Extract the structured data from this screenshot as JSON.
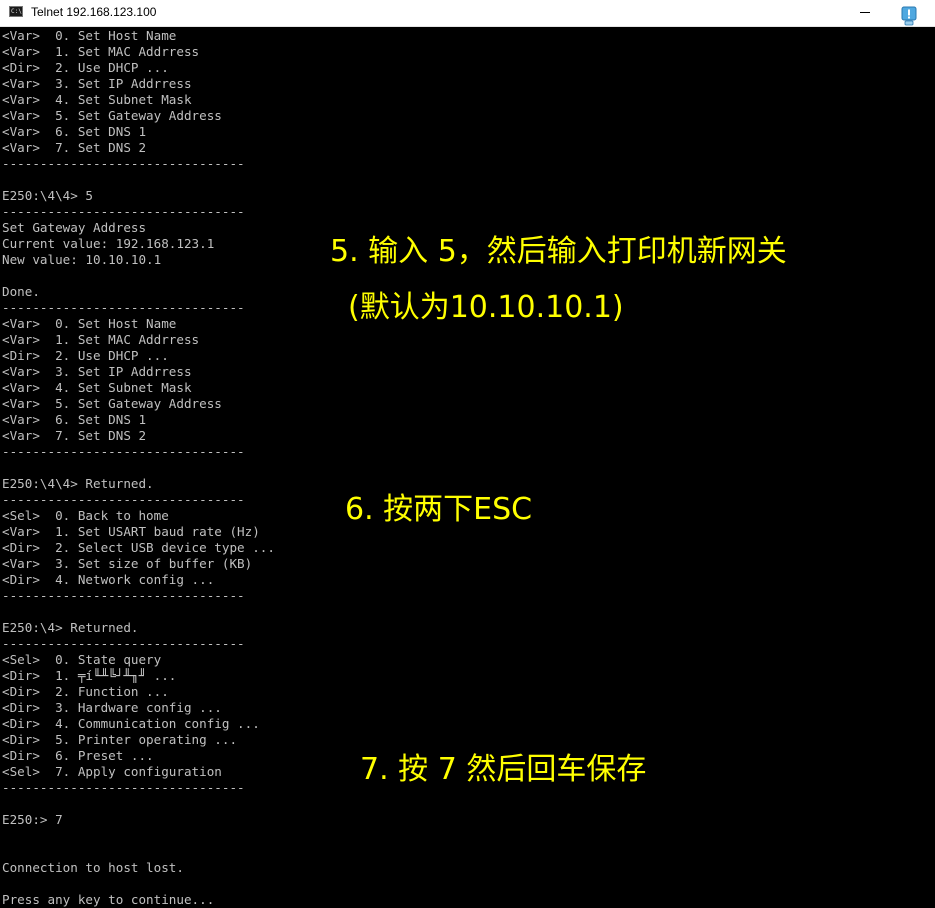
{
  "window": {
    "title": "Telnet 192.168.123.100",
    "app_icon_glyph": "C:\\",
    "minimize_glyph": ""
  },
  "terminal": {
    "lines": [
      "<Var>  0. Set Host Name",
      "<Var>  1. Set MAC Addrress",
      "<Dir>  2. Use DHCP ...",
      "<Var>  3. Set IP Addrress",
      "<Var>  4. Set Subnet Mask",
      "<Var>  5. Set Gateway Address",
      "<Var>  6. Set DNS 1",
      "<Var>  7. Set DNS 2",
      "--------------------------------",
      "",
      "E250:\\4\\4> 5",
      "--------------------------------",
      "Set Gateway Address",
      "Current value: 192.168.123.1",
      "New value: 10.10.10.1",
      "",
      "Done.",
      "--------------------------------",
      "<Var>  0. Set Host Name",
      "<Var>  1. Set MAC Addrress",
      "<Dir>  2. Use DHCP ...",
      "<Var>  3. Set IP Addrress",
      "<Var>  4. Set Subnet Mask",
      "<Var>  5. Set Gateway Address",
      "<Var>  6. Set DNS 1",
      "<Var>  7. Set DNS 2",
      "--------------------------------",
      "",
      "E250:\\4\\4> Returned.",
      "--------------------------------",
      "<Sel>  0. Back to home",
      "<Var>  1. Set USART baud rate (Hz)",
      "<Dir>  2. Select USB device type ...",
      "<Var>  3. Set size of buffer (KB)",
      "<Dir>  4. Network config ...",
      "--------------------------------",
      "",
      "E250:\\4> Returned.",
      "--------------------------------",
      "<Sel>  0. State query",
      "<Dir>  1. ╤í╙╨╚┘╨╖╜ ...",
      "<Dir>  2. Function ...",
      "<Dir>  3. Hardware config ...",
      "<Dir>  4. Communication config ...",
      "<Dir>  5. Printer operating ...",
      "<Dir>  6. Preset ...",
      "<Sel>  7. Apply configuration",
      "--------------------------------",
      "",
      "E250:> 7",
      "",
      "",
      "Connection to host lost.",
      "",
      "Press any key to continue..."
    ]
  },
  "annotations": {
    "step5_line1": "5. 输入 5，然后输入打印机新网关",
    "step5_line2": "(默认为10.10.10.1)",
    "step6": "6. 按两下ESC",
    "step7": "7. 按 7 然后回车保存"
  },
  "colors": {
    "annotation": "#ffff00",
    "terminal_text": "#c0c0c0",
    "terminal_bg": "#000000",
    "notify_icon": "#4fa8e0"
  },
  "icons": {
    "app_icon": "console-icon",
    "notify": "notification-icon"
  }
}
